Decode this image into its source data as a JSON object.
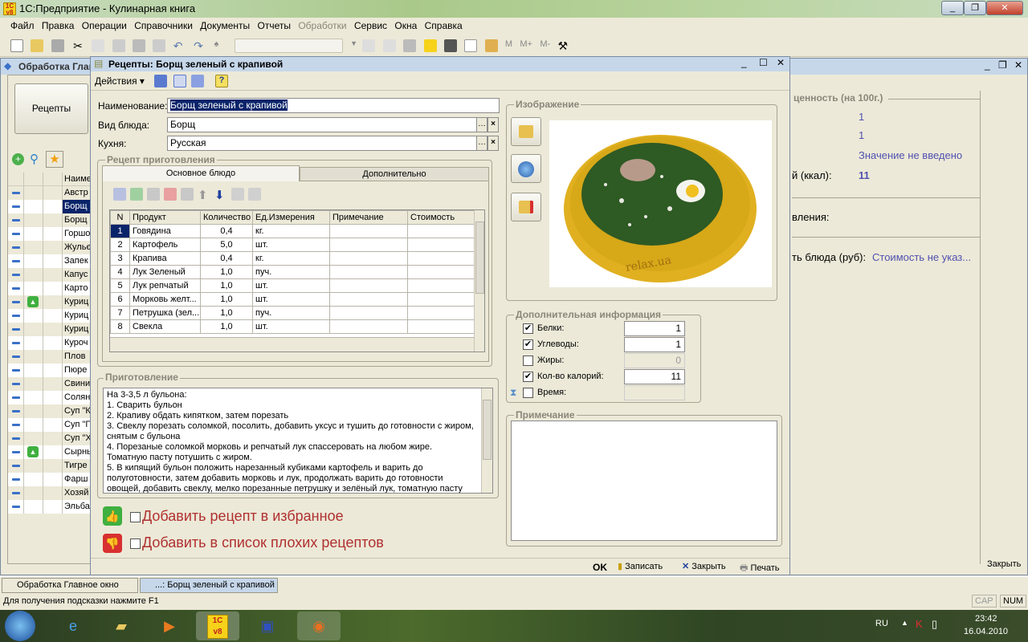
{
  "app": {
    "title": "1С:Предприятие - Кулинарная книга",
    "logo_text": "1C v8"
  },
  "menu": [
    "Файл",
    "Правка",
    "Операции",
    "Справочники",
    "Документы",
    "Отчеты",
    "Обработки",
    "Сервис",
    "Окна",
    "Справка"
  ],
  "toolbar": {
    "memory_buttons": [
      "M",
      "M+",
      "M-"
    ]
  },
  "bg_window": {
    "title": "Обработка  Главное окно",
    "recipes_button": "Рецепты",
    "column_header": "Наименование",
    "items": [
      "Австр",
      "Борщ",
      "Борщ",
      "Горшо",
      "Жульє",
      "Запек",
      "Капус",
      "Карто",
      "Куриц",
      "Куриц",
      "Куриц",
      "Куроч",
      "Плов",
      "Пюре",
      "Свини",
      "Солян",
      "Суп \"К",
      "Суп \"Г",
      "Суп \"Х",
      "Сырны",
      "Тигре",
      "Фарш",
      "Хозяй",
      "Эльба"
    ],
    "nutrition_group": "ценность (на 100г.)",
    "nutrition_values": [
      "1",
      "1",
      "Значение не введено"
    ],
    "calories_label": "й (ккал):",
    "calories_value": "11",
    "prep_label": "вления:",
    "cost_label": "ть блюда (руб):",
    "cost_value": "Стоимость не указ...",
    "close": "Закрыть"
  },
  "dialog": {
    "title": "Рецепты: Борщ зеленый с крапивой",
    "actions": "Действия",
    "name_label": "Наименование:",
    "name_value": "Борщ зеленый с крапивой",
    "dish_type_label": "Вид блюда:",
    "dish_type_value": "Борщ",
    "cuisine_label": "Кухня:",
    "cuisine_value": "Русская",
    "recipe_group": "Рецепт приготовления",
    "tabs": [
      "Основное блюдо",
      "Дополнительно"
    ],
    "table": {
      "headers": [
        "N",
        "Продукт",
        "Количество",
        "Ед.Измерения",
        "Примечание",
        "Стоимость"
      ],
      "rows": [
        [
          "1",
          "Говядина",
          "0,4",
          "кг."
        ],
        [
          "2",
          "Картофель",
          "5,0",
          "шт."
        ],
        [
          "3",
          "Крапива",
          "0,4",
          "кг."
        ],
        [
          "4",
          "Лук Зеленый",
          "1,0",
          "пуч."
        ],
        [
          "5",
          "Лук репчатый",
          "1,0",
          "шт."
        ],
        [
          "6",
          "Морковь желт...",
          "1,0",
          "шт."
        ],
        [
          "7",
          "Петрушка (зел...",
          "1,0",
          "пуч."
        ],
        [
          "8",
          "Свекла",
          "1,0",
          "шт."
        ]
      ]
    },
    "cooking_group": "Приготовление",
    "cooking_text": "На 3-3,5 л бульона:\n1. Сварить бульон\n2. Крапиву обдать кипятком, затем порезать\n3. Свеклу порезать соломкой, посолить, добавить уксус и тушить до готовности с жиром, снятым с бульона\n4. Порезаные соломкой морковь и репчатый лук спассеровать на любом жире. Томатную пасту потушить с жиром.\n5. В кипящий бульон положить нарезанный кубиками картофель и варить до полуготовности, затем добавить морковь и лук, продолжать варить до готовности овощей, добавить свеклу, мелко порезанные петрушку и зелёный лук, томатную пасту",
    "favorite_label": "Добавить рецепт в избранное",
    "bad_label": "Добавить в список плохих рецептов",
    "image_group": "Изображение",
    "image_watermark": "relax.ua",
    "extra_group": "Дополнительная информация",
    "extra": [
      {
        "label": "Белки:",
        "checked": true,
        "value": "1"
      },
      {
        "label": "Углеводы:",
        "checked": true,
        "value": "1"
      },
      {
        "label": "Жиры:",
        "checked": false,
        "value": "0"
      },
      {
        "label": "Кол-во калорий:",
        "checked": true,
        "value": "11"
      },
      {
        "label": "Время:",
        "checked": false,
        "value": ""
      }
    ],
    "note_group": "Примечание",
    "ok": "OK",
    "save": "Записать",
    "close": "Закрыть",
    "print": "Печать"
  },
  "windows_bar": [
    "Обработка  Главное окно",
    "...: Борщ зеленый с крапивой"
  ],
  "status": {
    "hint": "Для получения подсказки нажмите F1",
    "cap": "CAP",
    "num": "NUM"
  },
  "taskbar": {
    "lang": "RU",
    "time": "23:42",
    "date": "16.04.2010"
  },
  "colors": {
    "title_blue": "#c6d7ea",
    "link": "#5151b0",
    "bad_red": "#b03030",
    "selection": "#0a246a"
  }
}
